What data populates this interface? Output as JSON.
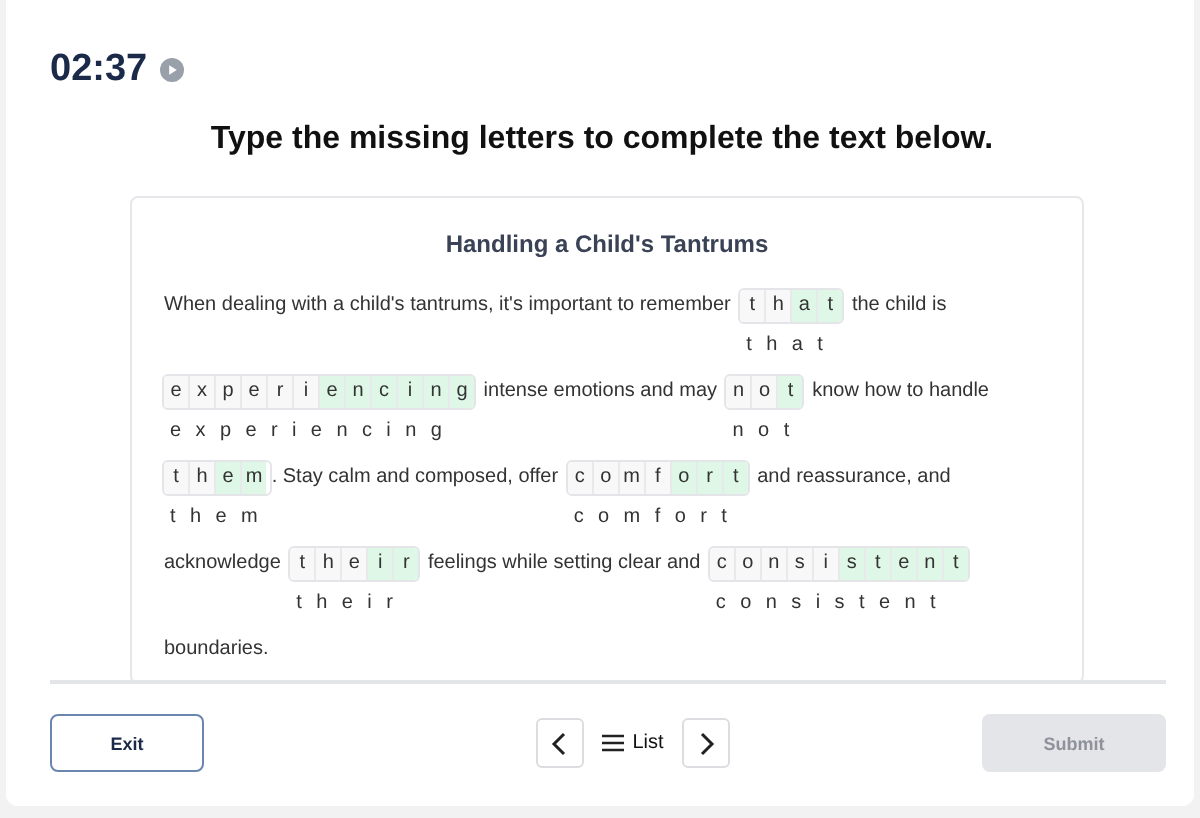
{
  "timer": "02:37",
  "instruction": "Type the missing letters to complete the text below.",
  "passage": {
    "title": "Handling a Child's Tantrums",
    "segments": [
      {
        "kind": "text",
        "text": "When dealing with a child's tantrums, it's important to remember"
      },
      {
        "kind": "blank",
        "answer": "that",
        "cells": [
          {
            "letter": "t",
            "filled": false
          },
          {
            "letter": "h",
            "filled": false
          },
          {
            "letter": "a",
            "filled": true
          },
          {
            "letter": "t",
            "filled": true
          }
        ]
      },
      {
        "kind": "text",
        "text": "the child is"
      },
      {
        "kind": "blank",
        "answer": "experiencing",
        "cells": [
          {
            "letter": "e",
            "filled": false
          },
          {
            "letter": "x",
            "filled": false
          },
          {
            "letter": "p",
            "filled": false
          },
          {
            "letter": "e",
            "filled": false
          },
          {
            "letter": "r",
            "filled": false
          },
          {
            "letter": "i",
            "filled": false
          },
          {
            "letter": "e",
            "filled": true
          },
          {
            "letter": "n",
            "filled": true
          },
          {
            "letter": "c",
            "filled": true
          },
          {
            "letter": "i",
            "filled": true
          },
          {
            "letter": "n",
            "filled": true
          },
          {
            "letter": "g",
            "filled": true
          }
        ]
      },
      {
        "kind": "text",
        "text": "intense emotions and may"
      },
      {
        "kind": "blank",
        "answer": "not",
        "cells": [
          {
            "letter": "n",
            "filled": false
          },
          {
            "letter": "o",
            "filled": false
          },
          {
            "letter": "t",
            "filled": true
          }
        ]
      },
      {
        "kind": "text",
        "text": "know how to handle"
      },
      {
        "kind": "blank",
        "answer": "them",
        "cells": [
          {
            "letter": "t",
            "filled": false
          },
          {
            "letter": "h",
            "filled": false
          },
          {
            "letter": "e",
            "filled": true
          },
          {
            "letter": "m",
            "filled": true
          }
        ]
      },
      {
        "kind": "text",
        "text": ". Stay calm and composed, offer"
      },
      {
        "kind": "blank",
        "answer": "comfort",
        "cells": [
          {
            "letter": "c",
            "filled": false
          },
          {
            "letter": "o",
            "filled": false
          },
          {
            "letter": "m",
            "filled": false
          },
          {
            "letter": "f",
            "filled": false
          },
          {
            "letter": "o",
            "filled": true
          },
          {
            "letter": "r",
            "filled": true
          },
          {
            "letter": "t",
            "filled": true
          }
        ]
      },
      {
        "kind": "text",
        "text": "and reassurance, and"
      },
      {
        "kind": "text",
        "text": "acknowledge"
      },
      {
        "kind": "blank",
        "answer": "their",
        "cells": [
          {
            "letter": "t",
            "filled": false
          },
          {
            "letter": "h",
            "filled": false
          },
          {
            "letter": "e",
            "filled": false
          },
          {
            "letter": "i",
            "filled": true
          },
          {
            "letter": "r",
            "filled": true
          }
        ]
      },
      {
        "kind": "text",
        "text": "feelings while setting clear and"
      },
      {
        "kind": "blank",
        "answer": "consistent",
        "cells": [
          {
            "letter": "c",
            "filled": false
          },
          {
            "letter": "o",
            "filled": false
          },
          {
            "letter": "n",
            "filled": false
          },
          {
            "letter": "s",
            "filled": false
          },
          {
            "letter": "i",
            "filled": false
          },
          {
            "letter": "s",
            "filled": true
          },
          {
            "letter": "t",
            "filled": true
          },
          {
            "letter": "e",
            "filled": true
          },
          {
            "letter": "n",
            "filled": true
          },
          {
            "letter": "t",
            "filled": true
          }
        ]
      },
      {
        "kind": "text",
        "text": "boundaries."
      }
    ]
  },
  "footer": {
    "exit": "Exit",
    "list": "List",
    "submit": {
      "label": "Submit",
      "disabled": true
    }
  }
}
